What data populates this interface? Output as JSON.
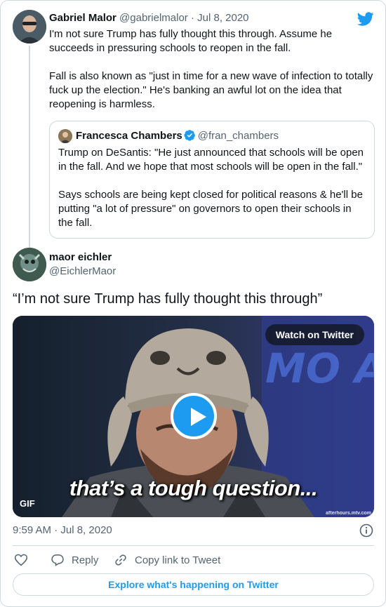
{
  "parent_tweet": {
    "name": "Gabriel Malor",
    "handle": "@gabrielmalor",
    "separator": "·",
    "date": "Jul 8, 2020",
    "text": "I'm not sure Trump has fully thought this through. Assume he\nsucceeds in pressuring schools to reopen in the fall.\n\nFall is also known as \"just in time for a new wave of infection to totally\nfuck up the election.\" He's banking an awful lot on the idea that\nreopening is harmless.",
    "quote": {
      "name": "Francesca Chambers",
      "handle": "@fran_chambers",
      "text": "Trump on DeSantis: \"He just announced that schools will be open\nin the fall. And we hope that most schools will be open in the fall.\"\n\nSays schools are being kept closed for political reasons & he'll be\nputting \"a lot of pressure\" on governors to open their schools in\nthe fall."
    }
  },
  "main_tweet": {
    "name": "maor eichler",
    "handle": "@EichlerMaor",
    "text": "“I’m not sure Trump has fully thought this through”",
    "media": {
      "watch_label": "Watch on Twitter",
      "caption": "that’s a tough question...",
      "badge": "GIF",
      "watermark": "afterhours.mtv.com",
      "sign_text": "MO AWA"
    },
    "timestamp": "9:59 AM · Jul 8, 2020"
  },
  "actions": {
    "like_icon": "heart-icon",
    "reply_label": "Reply",
    "copy_link_label": "Copy link to Tweet",
    "explore_label": "Explore what's happening on Twitter"
  },
  "colors": {
    "accent": "#1d9bf0",
    "muted_text": "#536471",
    "border": "#cfd9de"
  }
}
